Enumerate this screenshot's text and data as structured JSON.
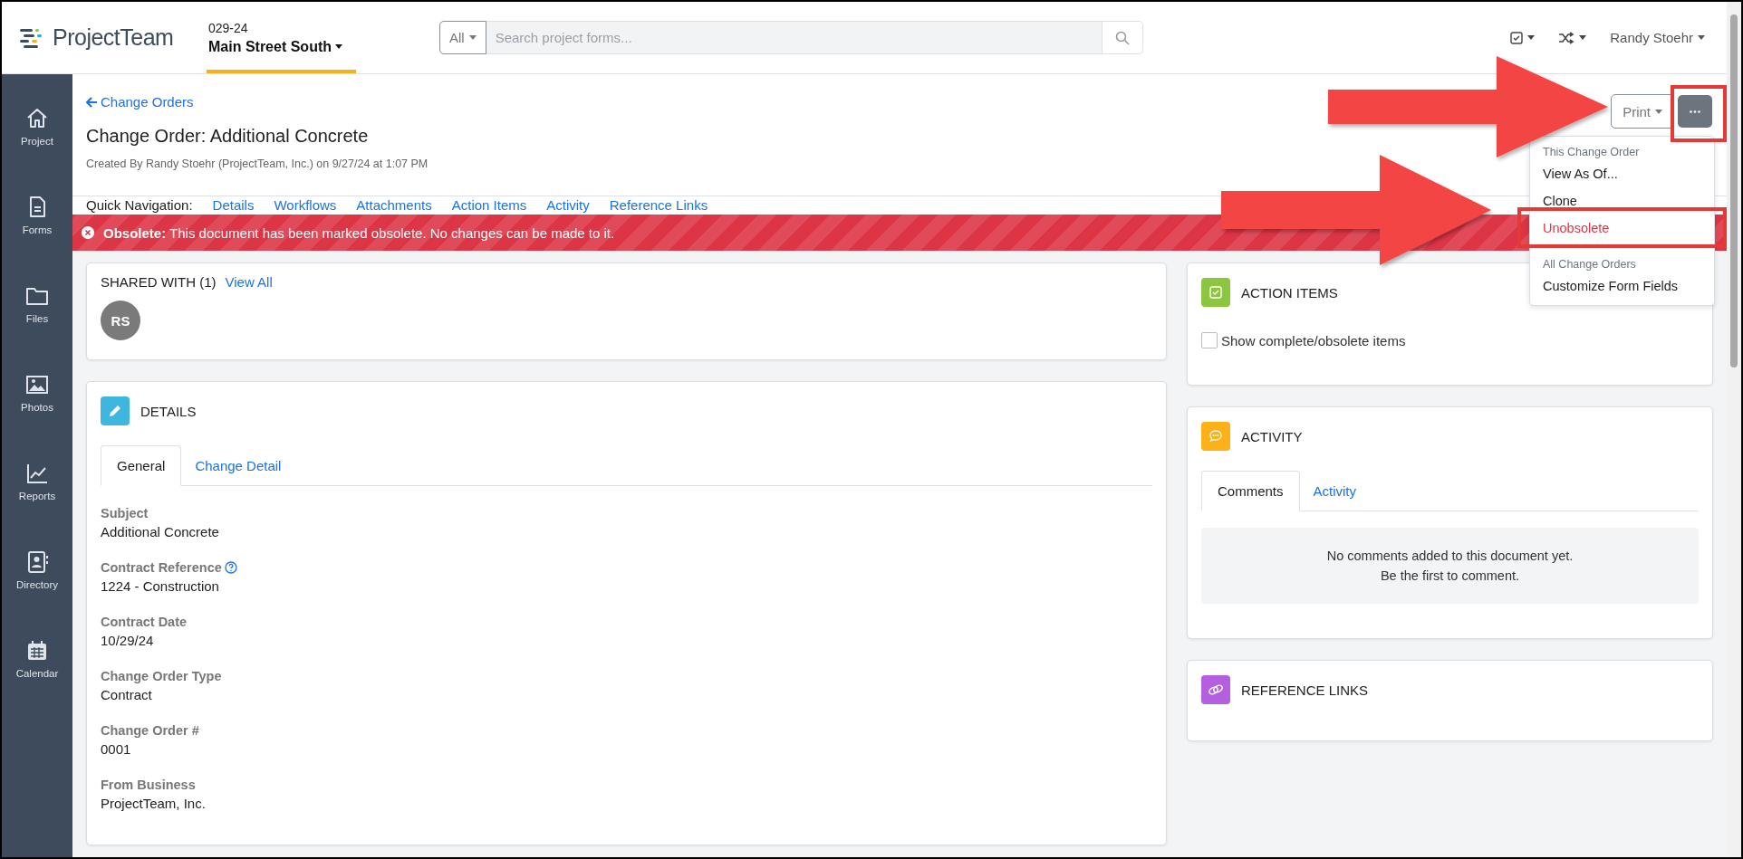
{
  "header": {
    "logo": "ProjectTeam",
    "project": {
      "number": "029-24",
      "name": "Main Street South"
    },
    "search": {
      "scope": "All",
      "placeholder": "Search project forms..."
    },
    "user": "Randy Stoehr"
  },
  "sidebar": {
    "items": [
      {
        "label": "Project"
      },
      {
        "label": "Forms"
      },
      {
        "label": "Files"
      },
      {
        "label": "Photos"
      },
      {
        "label": "Reports"
      },
      {
        "label": "Directory"
      },
      {
        "label": "Calendar"
      }
    ]
  },
  "page": {
    "back_link": "Change Orders",
    "title": "Change Order: Additional Concrete",
    "created_by": "Created By Randy Stoehr (ProjectTeam, Inc.) on 9/27/24 at 1:07 PM",
    "print_button": "Print"
  },
  "menu": {
    "sections": [
      {
        "header": "This Change Order",
        "items": [
          {
            "label": "View As Of...",
            "kind": "normal"
          },
          {
            "label": "Clone",
            "kind": "normal"
          },
          {
            "label": "Unobsolete",
            "kind": "danger"
          }
        ]
      },
      {
        "header": "All Change Orders",
        "items": [
          {
            "label": "Customize Form Fields",
            "kind": "normal"
          }
        ]
      }
    ]
  },
  "quick_navigation": {
    "label": "Quick Navigation:",
    "links": [
      "Details",
      "Workflows",
      "Attachments",
      "Action Items",
      "Activity",
      "Reference Links"
    ]
  },
  "alert": {
    "message": "**Obsolete:** This document has been marked obsolete. No changes can be made to it."
  },
  "shared_with": {
    "title": "SHARED WITH (1)",
    "link": "View All",
    "avatars": [
      "RS"
    ]
  },
  "details": {
    "title": "DETAILS",
    "tabs": [
      {
        "label": "General",
        "selected": true
      },
      {
        "label": "Change Detail",
        "selected": false
      }
    ],
    "fields": [
      {
        "label": "Subject",
        "value": "Additional Concrete",
        "help": false
      },
      {
        "label": "Contract Reference",
        "value": "1224 - Construction",
        "help": true
      },
      {
        "label": "Contract Date",
        "value": "10/29/24",
        "help": false
      },
      {
        "label": "Change Order Type",
        "value": "Contract",
        "help": false
      },
      {
        "label": "Change Order #",
        "value": "0001",
        "help": false
      },
      {
        "label": "From Business",
        "value": "ProjectTeam, Inc.",
        "help": false
      }
    ]
  },
  "action_items": {
    "title": "ACTION ITEMS",
    "checkbox": {
      "label": "Show complete/obsolete items",
      "checked": false
    }
  },
  "activity": {
    "title": "ACTIVITY",
    "tabs": [
      {
        "label": "Comments",
        "selected": true
      },
      {
        "label": "Activity",
        "selected": false
      }
    ],
    "empty_message": [
      "No comments added to this document yet.",
      "Be the first to comment."
    ]
  },
  "reference_links": {
    "title": "REFERENCE LINKS"
  }
}
